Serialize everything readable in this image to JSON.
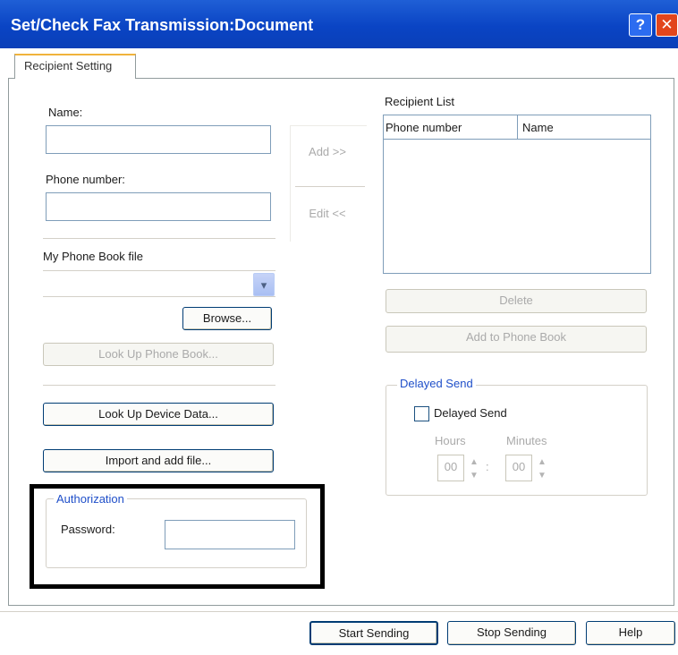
{
  "window": {
    "title": "Set/Check Fax Transmission:Document",
    "help_glyph": "?",
    "close_glyph": "✕"
  },
  "tab": {
    "label": "Recipient Setting"
  },
  "left": {
    "name_label": "Name:",
    "name_value": "",
    "phone_label": "Phone number:",
    "phone_value": "",
    "phonebook_label": "My Phone Book file",
    "phonebook_value": "",
    "combo_arrow": "▾",
    "browse_label": "Browse...",
    "lookup_phonebook_label": "Look Up Phone Book...",
    "lookup_device_label": "Look Up Device Data...",
    "import_label": "Import and add file..."
  },
  "middle": {
    "add_label": "Add >>",
    "edit_label": "Edit <<"
  },
  "recipient_list": {
    "title": "Recipient List",
    "columns": [
      "Phone number",
      "Name"
    ],
    "rows": []
  },
  "right": {
    "delete_label": "Delete",
    "add_phonebook_label": "Add to Phone Book"
  },
  "delayed": {
    "group_label": "Delayed Send",
    "checkbox_label": "Delayed Send",
    "checked": false,
    "hours_label": "Hours",
    "minutes_label": "Minutes",
    "hours_value": "00",
    "minutes_value": "00",
    "colon": ":",
    "up_arrow": "▲",
    "down_arrow": "▼"
  },
  "authorization": {
    "group_label": "Authorization",
    "password_label": "Password:",
    "password_value": ""
  },
  "footer": {
    "start_label": "Start Sending",
    "stop_label": "Stop Sending",
    "help_label": "Help"
  },
  "colors": {
    "titlebar": "#0a44c4",
    "close_button": "#e2451c",
    "highlight_border": "#000000",
    "group_title": "#1f4fc9"
  }
}
